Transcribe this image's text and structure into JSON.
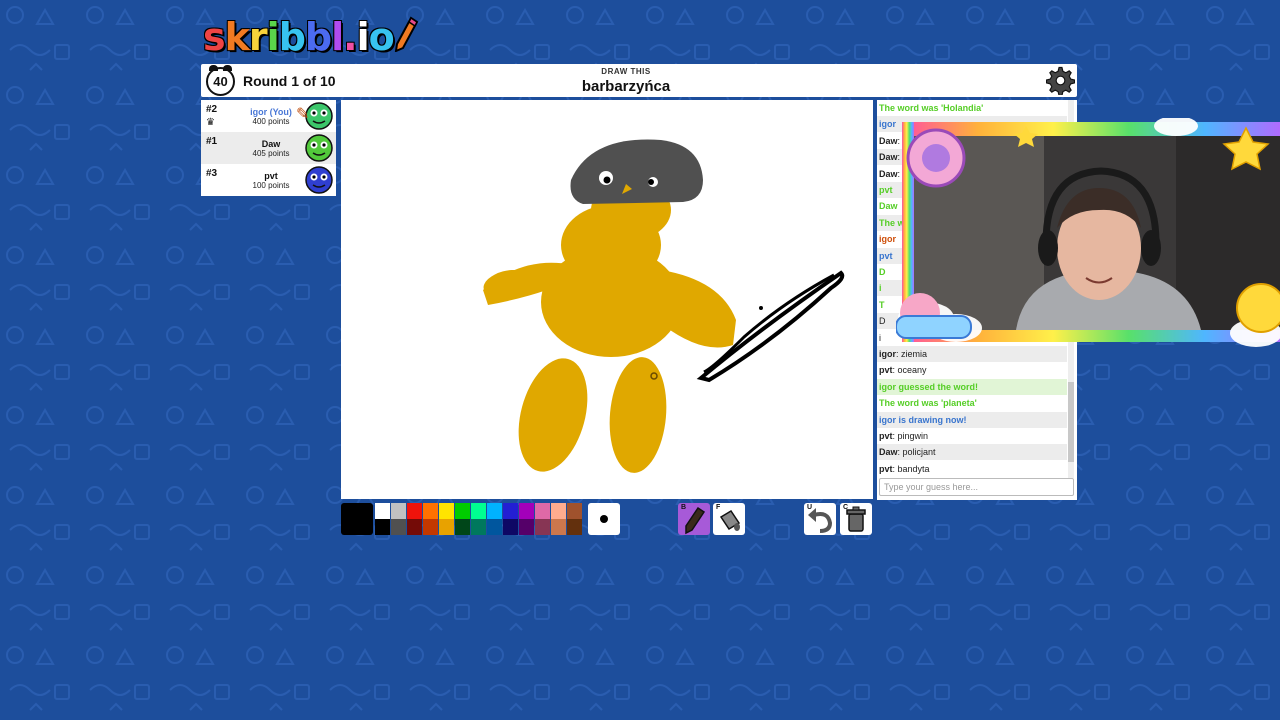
{
  "app": {
    "logo_text": "skribbl.io"
  },
  "header": {
    "timer": "40",
    "round": "Round 1 of 10",
    "draw_this_label": "DRAW THIS",
    "word": "barbarzyńca"
  },
  "players": [
    {
      "rank": "#2",
      "name": "igor (You)",
      "points": "400 points",
      "name_color": "#4a78d6",
      "avatar_color": "#3cc66a",
      "drawing": true,
      "host": true
    },
    {
      "rank": "#1",
      "name": "Daw",
      "points": "405 points",
      "name_color": "#111111",
      "avatar_color": "#52c93b",
      "drawing": false,
      "host": false
    },
    {
      "rank": "#3",
      "name": "pvt",
      "points": "100 points",
      "name_color": "#111111",
      "avatar_color": "#2f3fd0",
      "drawing": false,
      "host": false
    }
  ],
  "chat": {
    "messages": [
      {
        "text": "The word was 'Holandia'",
        "kind": "system-green"
      },
      {
        "text": "igor",
        "kind": "system-blue"
      },
      {
        "author": "Daw",
        "text": "",
        "kind": "normal"
      },
      {
        "author": "Daw",
        "text": "",
        "kind": "normal"
      },
      {
        "author": "Daw",
        "text": "",
        "kind": "normal"
      },
      {
        "text": "pvt",
        "kind": "system-green"
      },
      {
        "text": "Daw",
        "kind": "system-green"
      },
      {
        "text": "The w",
        "kind": "system-green"
      },
      {
        "text": "igor",
        "kind": "system-orange"
      },
      {
        "text": "pvt",
        "kind": "system-blue"
      },
      {
        "text": "D",
        "kind": "system-green"
      },
      {
        "text": "i",
        "kind": "system-green"
      },
      {
        "text": "T",
        "kind": "system-green"
      },
      {
        "text": "D",
        "kind": "normal"
      },
      {
        "text": "i",
        "kind": "normal"
      },
      {
        "author": "igor",
        "text": "ziemia",
        "kind": "normal"
      },
      {
        "author": "pvt",
        "text": "oceany",
        "kind": "normal"
      },
      {
        "text": "igor guessed the word!",
        "kind": "guessed"
      },
      {
        "text": "The word was 'planeta'",
        "kind": "system-green"
      },
      {
        "text": "igor is drawing now!",
        "kind": "system-blue"
      },
      {
        "author": "pvt",
        "text": "pingwin",
        "kind": "normal"
      },
      {
        "author": "Daw",
        "text": "policjant",
        "kind": "normal"
      },
      {
        "author": "pvt",
        "text": "bandyta",
        "kind": "normal"
      }
    ],
    "input_placeholder": "Type your guess here..."
  },
  "palette": {
    "selected": "#000000",
    "colors_top": [
      "#ffffff",
      "#c1c1c1",
      "#ef130b",
      "#ff7100",
      "#ffe400",
      "#00cc00",
      "#00ff91",
      "#00b2ff",
      "#231fd3",
      "#a300ba",
      "#df69a7",
      "#ffac8e",
      "#a0522d"
    ],
    "colors_bottom": [
      "#000000",
      "#505050",
      "#740b07",
      "#c23800",
      "#e8a200",
      "#004619",
      "#00785d",
      "#00569e",
      "#0e0865",
      "#550069",
      "#873554",
      "#cc774d",
      "#63300d"
    ]
  },
  "tools": {
    "brush_key": "B",
    "fill_key": "F",
    "undo_key": "U",
    "clear_key": "C"
  },
  "colors": {
    "background": "#1d4e9c",
    "accent_pencil": "#a75ad8",
    "drawing_yellow": "#e0a800",
    "drawing_gray": "#505050"
  }
}
